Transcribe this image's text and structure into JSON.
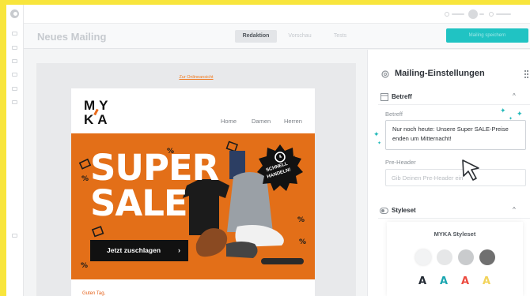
{
  "header": {
    "page_title": "Neues Mailing",
    "tabs": [
      {
        "label": "Redaktion",
        "active": true
      },
      {
        "label": "Vorschau",
        "active": false
      },
      {
        "label": "Tests",
        "active": false
      }
    ],
    "cta_label": "Mailing speichern",
    "cta_color": "#20c3c3"
  },
  "email": {
    "online_link": "Zur Onlineansicht",
    "brand_line1": "MY",
    "brand_line2": "KA",
    "nav": [
      "Home",
      "Damen",
      "Herren"
    ],
    "hero_line1": "SUPER",
    "hero_line2": "SALE",
    "badge_line1": "SCHNELL",
    "badge_line2": "HANDELN!",
    "hero_button": "Jetzt zuschlagen",
    "hero_color": "#e36f18",
    "greeting": "Guten Tag,"
  },
  "panel": {
    "title": "Mailing-Einstellungen",
    "betreff_section": "Betreff",
    "betreff_label": "Betreff",
    "betreff_value": "Nur noch heute: Unsere Super SALE-Preise enden um Mitternacht!",
    "preheader_label": "Pre-Header",
    "preheader_placeholder": "Gib Deinen Pre-Header ein",
    "styleset_section": "Styleset",
    "styleset_name": "MYKA Styleset",
    "swatches": [
      "#f2f3f4",
      "#e6e7e8",
      "#c9cbcd",
      "#707070"
    ],
    "font_samples": [
      {
        "char": "A",
        "color": "#232a33"
      },
      {
        "char": "A",
        "color": "#1aa6b0"
      },
      {
        "char": "A",
        "color": "#ec4a3f"
      },
      {
        "char": "A",
        "color": "#f2d35a"
      }
    ]
  }
}
